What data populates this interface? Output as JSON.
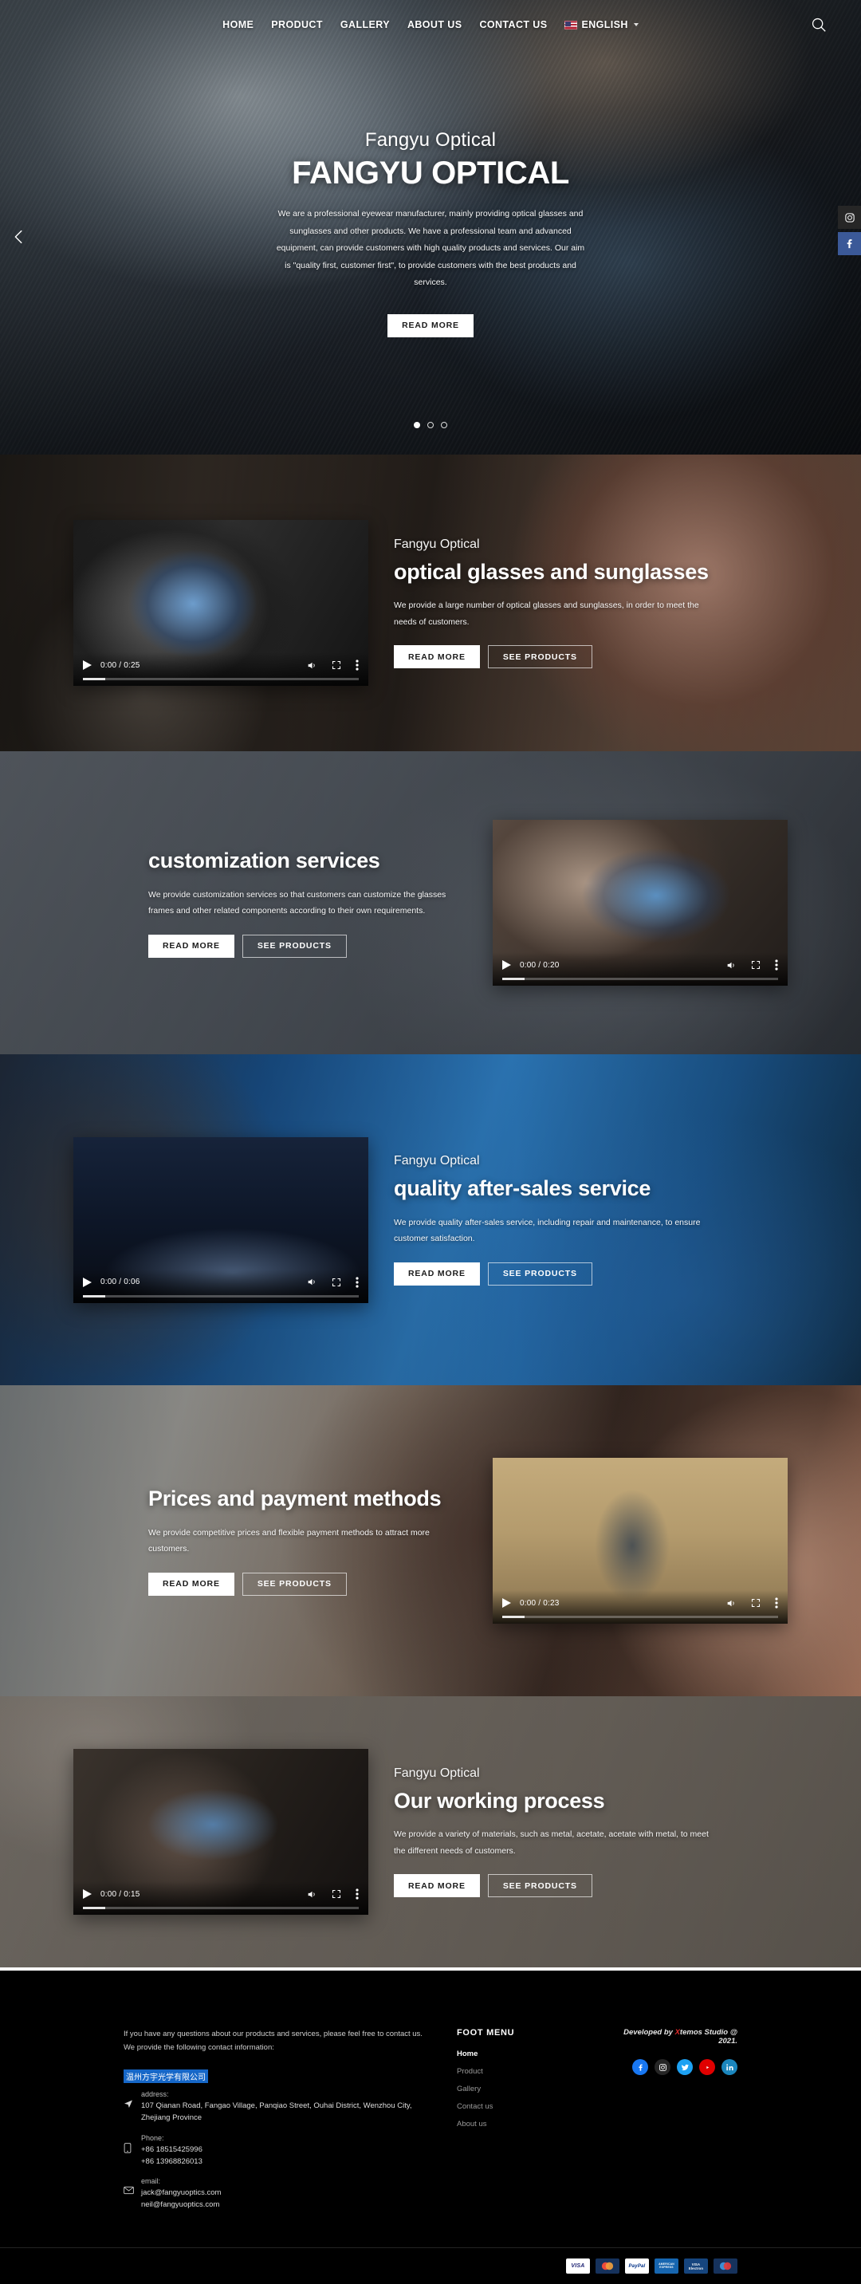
{
  "header": {
    "nav": [
      {
        "label": "HOME",
        "name": "nav-home"
      },
      {
        "label": "PRODUCT",
        "name": "nav-product"
      },
      {
        "label": "GALLERY",
        "name": "nav-gallery"
      },
      {
        "label": "ABOUT US",
        "name": "nav-about-us"
      },
      {
        "label": "CONTACT US",
        "name": "nav-contact-us"
      }
    ],
    "language": "ENGLISH",
    "search_icon": "search-icon"
  },
  "hero": {
    "eyebrow": "Fangyu Optical",
    "title": "FANGYU OPTICAL",
    "paragraph": "We are a professional eyewear manufacturer, mainly providing optical glasses and sunglasses and other products. We have a professional team and advanced equipment, can provide customers with high quality products and services. Our aim is \"quality first, customer first\", to provide customers with the best products and services.",
    "button": "READ MORE",
    "prev_icon": "chevron-left-icon",
    "dots": 3,
    "active_dot": 0
  },
  "side_float": [
    {
      "name": "instagram-float-button",
      "icon": "instagram-icon",
      "color": "#262626"
    },
    {
      "name": "facebook-float-button",
      "icon": "facebook-icon",
      "color": "#3b5998"
    }
  ],
  "sections": [
    {
      "id": "optical-glasses",
      "eyebrow": "Fangyu Optical",
      "title": "optical glasses and sunglasses",
      "paragraph": "We provide a large number of optical glasses and sunglasses, in order to meet the needs of customers.",
      "buttons": [
        "READ MORE",
        "SEE PRODUCTS"
      ],
      "video": {
        "time": "0:00 / 0:25"
      },
      "layout": "video-left"
    },
    {
      "id": "customization-services",
      "eyebrow": "",
      "title": "customization services",
      "paragraph": "We provide customization services so that customers can customize the glasses frames and other related components according to their own requirements.",
      "buttons": [
        "READ MORE",
        "SEE PRODUCTS"
      ],
      "video": {
        "time": "0:00 / 0:20"
      },
      "layout": "video-right"
    },
    {
      "id": "after-sales-service",
      "eyebrow": "Fangyu Optical",
      "title": "quality after-sales service",
      "paragraph": "We provide quality after-sales service, including repair and maintenance, to ensure customer satisfaction.",
      "buttons": [
        "READ MORE",
        "SEE PRODUCTS"
      ],
      "video": {
        "time": "0:00 / 0:06"
      },
      "layout": "video-left"
    },
    {
      "id": "prices-payment",
      "eyebrow": "",
      "title": "Prices and payment methods",
      "paragraph": "We provide competitive prices and flexible payment methods to attract more customers.",
      "buttons": [
        "READ MORE",
        "SEE PRODUCTS"
      ],
      "video": {
        "time": "0:00 / 0:23"
      },
      "layout": "video-right"
    },
    {
      "id": "working-process",
      "eyebrow": "Fangyu Optical",
      "title": "Our working process",
      "paragraph": "We provide a variety of materials, such as metal, acetate, acetate with metal, to meet the different needs of customers.",
      "buttons": [
        "READ MORE",
        "SEE PRODUCTS"
      ],
      "video": {
        "time": "0:00 / 0:15"
      },
      "layout": "video-left"
    }
  ],
  "footer": {
    "intro": "If you have any questions about our products and services, please feel free to contact us. We provide the following contact information:",
    "company": "温州方宇光学有限公司",
    "address_label": "address:",
    "address_value": "107 Qianan Road, Fangao Village, Panqiao Street, Ouhai District, Wenzhou City, Zhejiang Province",
    "phone_label": "Phone:",
    "phone_1": "+86 18515425996",
    "phone_2": "+86 13968826013",
    "email_label": "email:",
    "email_1": "jack@fangyuoptics.com",
    "email_2": "neil@fangyuoptics.com",
    "menu_heading": "FOOT MENU",
    "menu": [
      {
        "label": "Home",
        "active": true
      },
      {
        "label": "Product",
        "active": false
      },
      {
        "label": "Gallery",
        "active": false
      },
      {
        "label": "Contact us",
        "active": false
      },
      {
        "label": "About us",
        "active": false
      }
    ],
    "developed_prefix": "Developed by ",
    "developed_brand": "X",
    "developed_suffix": "temos Studio @ 2021.",
    "socials": [
      {
        "name": "facebook-icon",
        "color": "#1877f2"
      },
      {
        "name": "instagram-icon",
        "color": "#262626"
      },
      {
        "name": "twitter-icon",
        "color": "#1da1f2"
      },
      {
        "name": "youtube-icon",
        "color": "#e00000"
      },
      {
        "name": "linkedin-icon",
        "color": "#1b86bd"
      }
    ],
    "payments": [
      {
        "name": "visa-icon",
        "label": "VISA",
        "bg": "#ffffff",
        "fg": "#1a1f71"
      },
      {
        "name": "mastercard-icon",
        "label": "",
        "bg": "#16325c",
        "fg": "#ffffff"
      },
      {
        "name": "paypal-icon",
        "label": "PayPal",
        "bg": "#ffffff",
        "fg": "#003087"
      },
      {
        "name": "amex-icon",
        "label": "AMERICAN EXPRESS",
        "bg": "#1766b0",
        "fg": "#ffffff"
      },
      {
        "name": "visa-electron-icon",
        "label": "VISA Electron",
        "bg": "#16457e",
        "fg": "#ffffff"
      },
      {
        "name": "maestro-icon",
        "label": "Maestro",
        "bg": "#16325c",
        "fg": "#ffffff"
      }
    ]
  },
  "video_controls": {
    "play_icon": "play-icon",
    "volume_icon": "volume-icon",
    "fullscreen_icon": "fullscreen-icon",
    "more_icon": "more-options-icon"
  }
}
